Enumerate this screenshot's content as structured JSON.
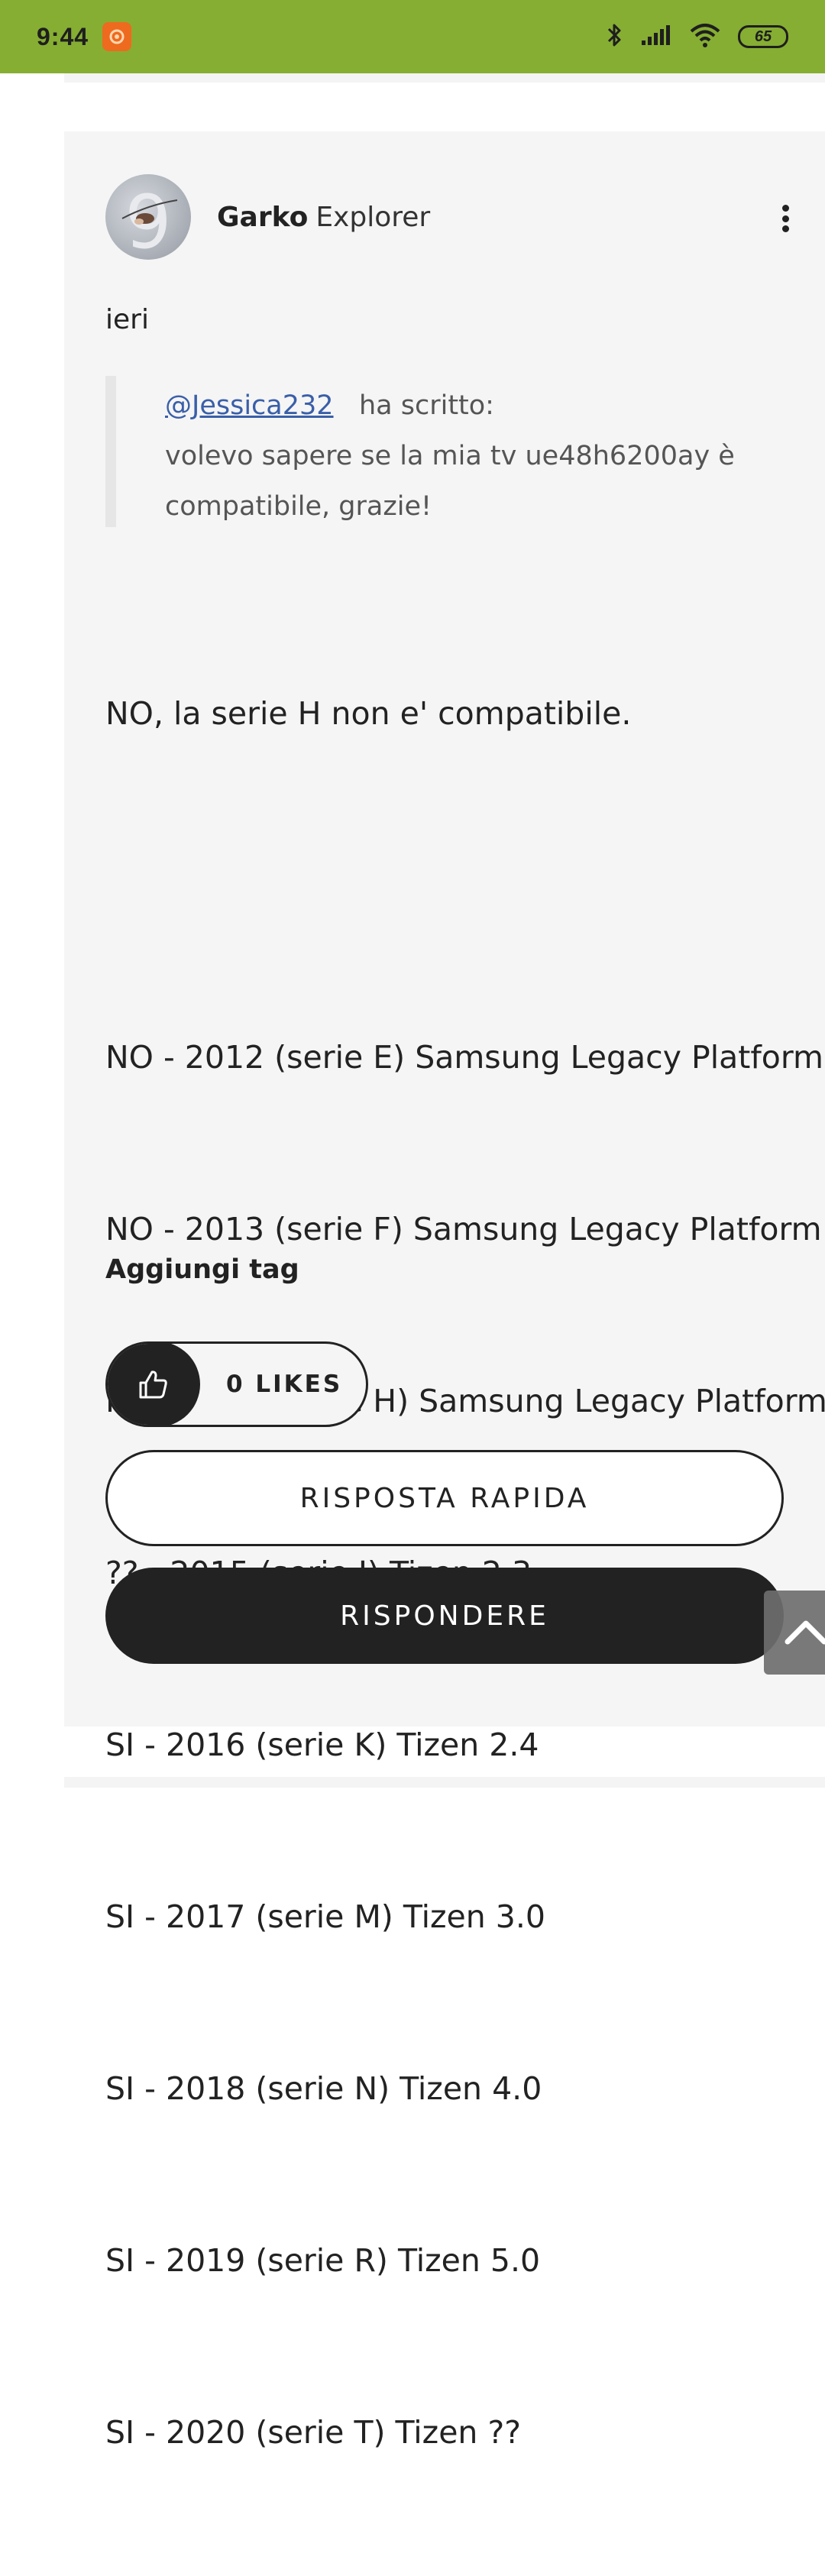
{
  "status_bar": {
    "time": "9:44",
    "battery": "65",
    "icons": [
      "notification-app-icon",
      "bluetooth-icon",
      "signal-icon",
      "wifi-icon",
      "battery-icon"
    ]
  },
  "post": {
    "author_name": "Garko",
    "author_rank": "Explorer",
    "date": "ieri",
    "quote": {
      "user": "@Jessica232",
      "wrote": "ha scritto:",
      "line1": "volevo sapere se la mia tv ue48h6200ay è",
      "line2": "compatibile, grazie!"
    },
    "body_lines": [
      "NO, la serie H non e' compatibile.",
      "",
      "NO - 2012 (serie E) Samsung Legacy Platform",
      "NO - 2013 (serie F) Samsung Legacy Platform",
      "NO - 2014 (serie H) Samsung Legacy Platform",
      "?? - 2015 (serie J) Tizen 2.3",
      "SI - 2016 (serie K) Tizen 2.4",
      "SI - 2017 (serie M) Tizen 3.0",
      "SI - 2018 (serie N) Tizen 4.0",
      "SI - 2019 (serie R) Tizen 5.0",
      "SI - 2020 (serie T) Tizen ??"
    ],
    "tags_label": "Aggiungi tag",
    "likes_label": "0 LIKES",
    "quick_reply_label": "RISPOSTA RAPIDA",
    "reply_label": "RISPONDERE"
  },
  "colors": {
    "status_bar": "#86ae33",
    "card_bg": "#f5f5f5",
    "dark": "#222222",
    "link": "#3a5fa8"
  }
}
